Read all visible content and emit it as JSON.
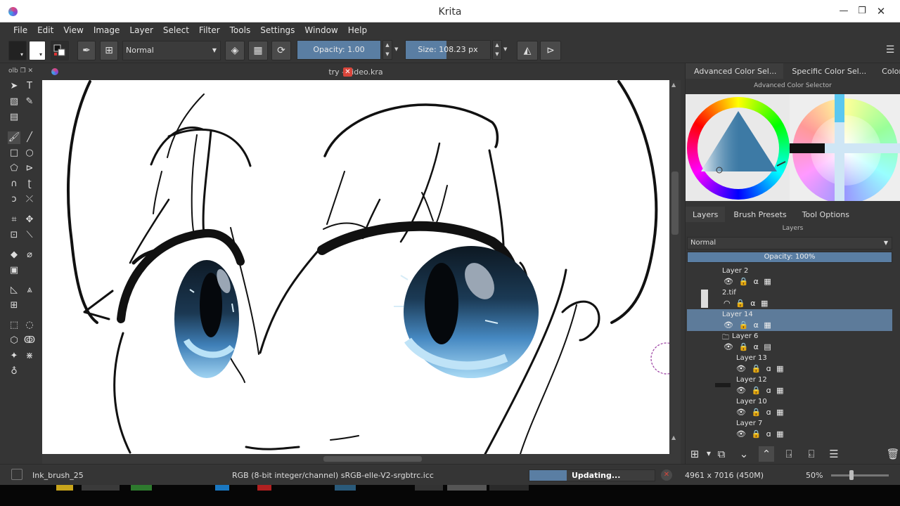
{
  "window": {
    "title": "Krita",
    "minimize": "—",
    "restore": "❐",
    "close": "✕"
  },
  "menubar": [
    "File",
    "Edit",
    "View",
    "Image",
    "Layer",
    "Select",
    "Filter",
    "Tools",
    "Settings",
    "Window",
    "Help"
  ],
  "toolbar": {
    "blend_mode": "Normal",
    "opacity_label": "Opacity:  1.00",
    "opacity_value": 1.0,
    "size_label": "Size:  108.23 px",
    "size_value": 108.23
  },
  "toolbox": {
    "header": "olb"
  },
  "document": {
    "tab_title": "try - video.kra",
    "close": "✕"
  },
  "docker_top": {
    "tabs": [
      "Advanced Color Sel...",
      "Specific Color Sel...",
      "Color Sli..."
    ],
    "title": "Advanced Color Selector"
  },
  "docker_bottom": {
    "tabs": [
      "Layers",
      "Brush Presets",
      "Tool Options"
    ],
    "title": "Layers",
    "blend_mode": "Normal",
    "opacity_label": "Opacity:  100%",
    "opacity_value": 100
  },
  "layers": [
    {
      "name": "Layer 2",
      "indent": 0,
      "selected": false,
      "icons": "👁 🔒 α ▦"
    },
    {
      "name": "2.tif",
      "indent": 0,
      "selected": false,
      "icons": "◠ 🔒 α ▦"
    },
    {
      "name": "Layer 14",
      "indent": 0,
      "selected": true,
      "icons": "👁 🔒 α ▦"
    },
    {
      "name": "Layer 6",
      "indent": 0,
      "selected": false,
      "icons": "👁 🔒 α ▤",
      "group": true
    },
    {
      "name": "Layer 13",
      "indent": 1,
      "selected": false,
      "icons": "👁 🔒 ɑ ▦"
    },
    {
      "name": "Layer 12",
      "indent": 1,
      "selected": false,
      "icons": "👁 🔒 ɑ ▦"
    },
    {
      "name": "Layer 10",
      "indent": 1,
      "selected": false,
      "icons": "👁 🔒 ɑ ▦"
    },
    {
      "name": "Layer 7",
      "indent": 1,
      "selected": false,
      "icons": "👁 🔒 ɑ ▦"
    }
  ],
  "statusbar": {
    "brush": "Ink_brush_25",
    "colorspace": "RGB (8-bit integer/channel)  sRGB-elle-V2-srgbtrc.icc",
    "progress_label": "Updating...",
    "progress_value": 0.3,
    "dimensions": "4961 x 7016 (450M)",
    "zoom": "50%",
    "zoom_value": 50
  },
  "colors": {
    "accent": "#5a7ea3",
    "selected_layer": "#5d7b9a",
    "close_red": "#d9453b",
    "panel": "#353535"
  }
}
